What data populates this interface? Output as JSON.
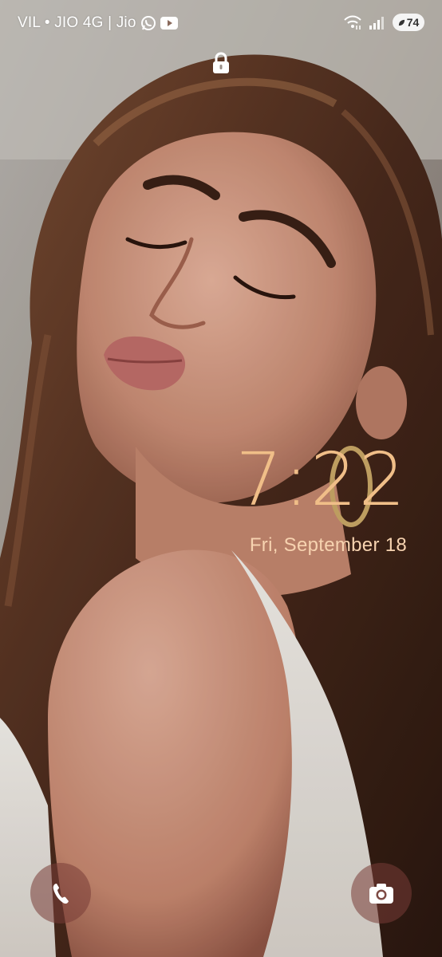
{
  "status_bar": {
    "carrier_text": "VIL • JIO 4G | Jio",
    "notification_icons": [
      "whatsapp-icon",
      "youtube-icon"
    ],
    "right_icons": [
      "wifi-icon",
      "signal-icon"
    ],
    "battery_level": "74",
    "battery_saver": true
  },
  "lock_screen": {
    "locked": true,
    "time": "7:22",
    "date": "Fri, September 18"
  },
  "shortcuts": {
    "left": "phone-icon",
    "right": "camera-icon"
  },
  "colors": {
    "clock": "#f0be88",
    "date": "#f7d3b0",
    "shortcut_bg": "#783c37"
  }
}
